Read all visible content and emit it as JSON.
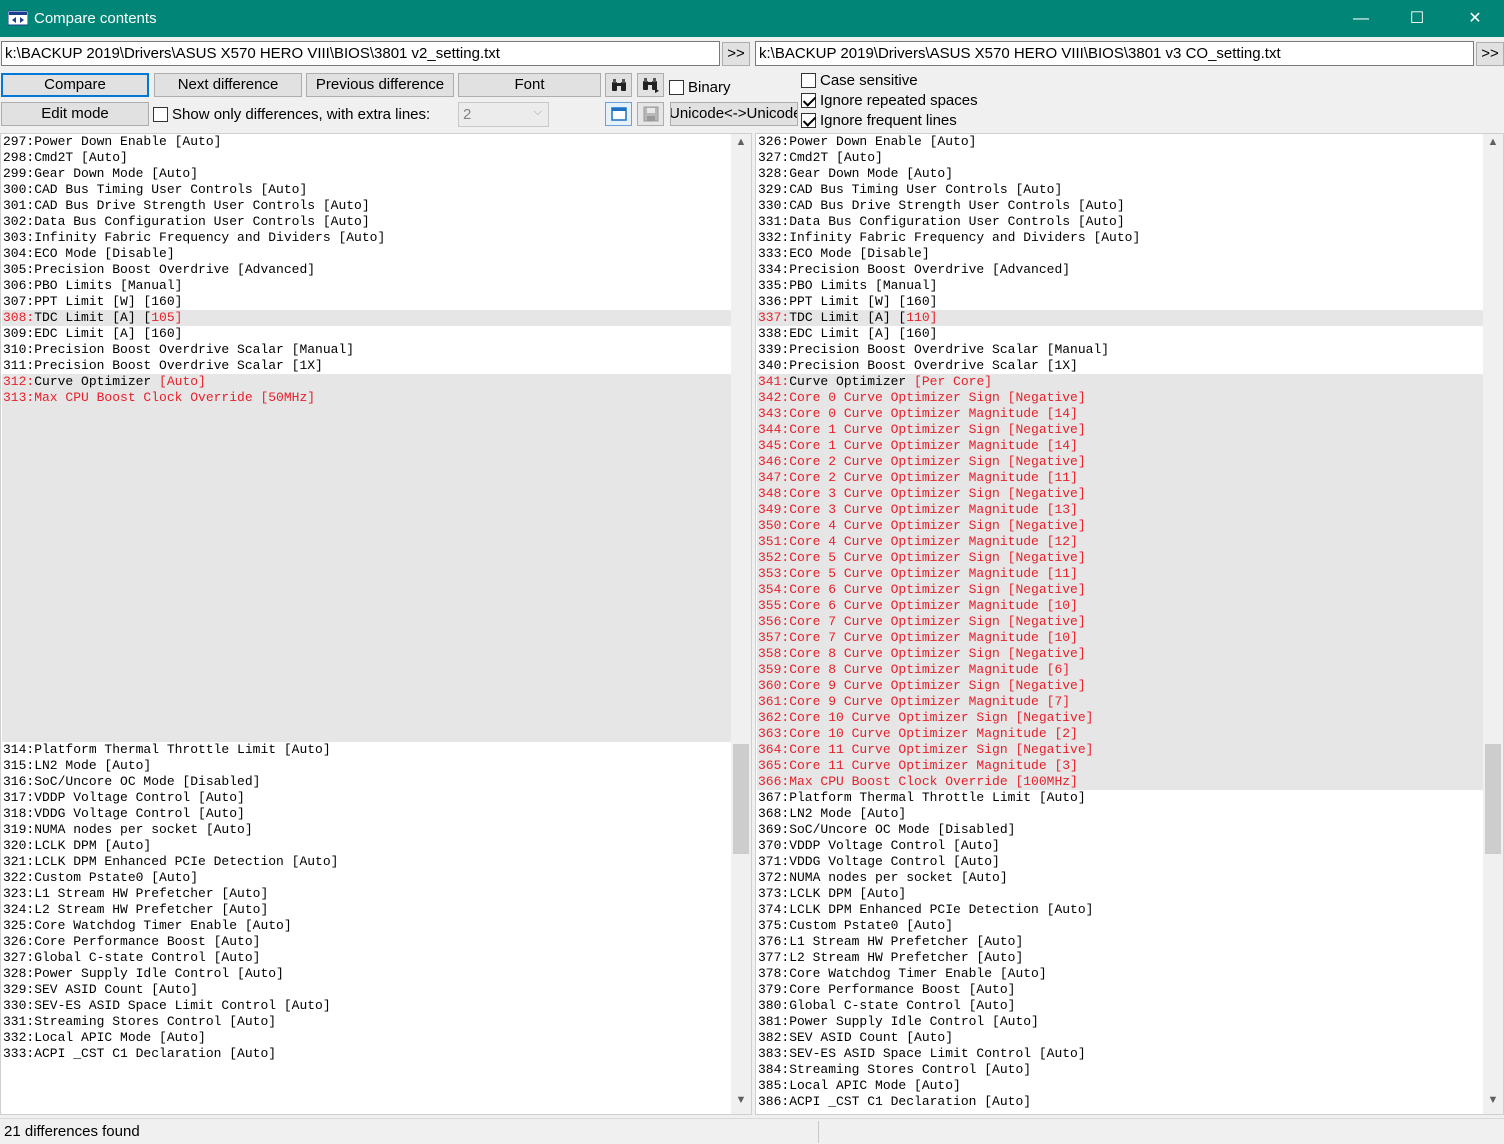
{
  "window": {
    "title": "Compare contents",
    "minimize_glyph": "—",
    "maximize_glyph": "☐",
    "close_glyph": "✕",
    "accent_color": "#008577"
  },
  "left_path": "k:\\BACKUP 2019\\Drivers\\ASUS X570 HERO VIII\\BIOS\\3801 v2_setting.txt",
  "right_path": "k:\\BACKUP 2019\\Drivers\\ASUS X570 HERO VIII\\BIOS\\3801 v3 CO_setting.txt",
  "toolbar": {
    "browse_label": ">>",
    "compare_label": "Compare",
    "next_label": "Next difference",
    "previous_label": "Previous difference",
    "font_label": "Font",
    "edit_label": "Edit mode",
    "binary_label": "Binary",
    "show_only_label": "Show only differences, with extra lines:",
    "extra_lines_value": "2",
    "unicode_label": "Unicode<->Unicode",
    "case_sensitive_label": "Case sensitive",
    "ignore_spaces_label": "Ignore repeated spaces",
    "ignore_frequent_label": "Ignore frequent lines",
    "icons": [
      "find-icon",
      "find-next-icon",
      "window-icon",
      "save-icon"
    ]
  },
  "options": {
    "binary": false,
    "show_only_differences": false,
    "case_sensitive": false,
    "ignore_repeated_spaces": true,
    "ignore_frequent_lines": true
  },
  "left_lines": [
    {
      "text": "297:Power Down Enable [Auto]"
    },
    {
      "text": "298:Cmd2T [Auto]"
    },
    {
      "text": "299:Gear Down Mode [Auto]"
    },
    {
      "text": "300:CAD Bus Timing User Controls [Auto]"
    },
    {
      "text": "301:CAD Bus Drive Strength User Controls [Auto]"
    },
    {
      "text": "302:Data Bus Configuration User Controls [Auto]"
    },
    {
      "text": "303:Infinity Fabric Frequency and Dividers [Auto]"
    },
    {
      "text": "304:ECO Mode [Disable]"
    },
    {
      "text": "305:Precision Boost Overdrive [Advanced]"
    },
    {
      "text": "306:PBO Limits [Manual]"
    },
    {
      "text": "307:PPT Limit [W] [160]"
    },
    {
      "num": "308:",
      "text": "TDC Limit [A] [",
      "diff": "105]",
      "shade": true
    },
    {
      "text": "309:EDC Limit [A] [160]"
    },
    {
      "text": "310:Precision Boost Overdrive Scalar [Manual]"
    },
    {
      "text": "311:Precision Boost Overdrive Scalar [1X]"
    },
    {
      "num": "312:",
      "text": "Curve Optimizer ",
      "diff": "[Auto]",
      "shade": true
    },
    {
      "text": "313:Max CPU Boost Clock Override [50MHz]",
      "red": true,
      "shade": true
    },
    {
      "text": "",
      "filler": true
    },
    {
      "text": "",
      "filler": true
    },
    {
      "text": "",
      "filler": true
    },
    {
      "text": "",
      "filler": true
    },
    {
      "text": "",
      "filler": true
    },
    {
      "text": "",
      "filler": true
    },
    {
      "text": "",
      "filler": true
    },
    {
      "text": "",
      "filler": true
    },
    {
      "text": "",
      "filler": true
    },
    {
      "text": "",
      "filler": true
    },
    {
      "text": "",
      "filler": true
    },
    {
      "text": "",
      "filler": true
    },
    {
      "text": "",
      "filler": true
    },
    {
      "text": "",
      "filler": true
    },
    {
      "text": "",
      "filler": true
    },
    {
      "text": "",
      "filler": true
    },
    {
      "text": "",
      "filler": true
    },
    {
      "text": "",
      "filler": true
    },
    {
      "text": "",
      "filler": true
    },
    {
      "text": "",
      "filler": true
    },
    {
      "text": "",
      "filler": true
    },
    {
      "text": "314:Platform Thermal Throttle Limit [Auto]"
    },
    {
      "text": "315:LN2 Mode [Auto]"
    },
    {
      "text": "316:SoC/Uncore OC Mode [Disabled]"
    },
    {
      "text": "317:VDDP Voltage Control [Auto]"
    },
    {
      "text": "318:VDDG Voltage Control [Auto]"
    },
    {
      "text": "319:NUMA nodes per socket [Auto]"
    },
    {
      "text": "320:LCLK DPM [Auto]"
    },
    {
      "text": "321:LCLK DPM Enhanced PCIe Detection [Auto]"
    },
    {
      "text": "322:Custom Pstate0 [Auto]"
    },
    {
      "text": "323:L1 Stream HW Prefetcher [Auto]"
    },
    {
      "text": "324:L2 Stream HW Prefetcher [Auto]"
    },
    {
      "text": "325:Core Watchdog Timer Enable [Auto]"
    },
    {
      "text": "326:Core Performance Boost [Auto]"
    },
    {
      "text": "327:Global C-state Control [Auto]"
    },
    {
      "text": "328:Power Supply Idle Control [Auto]"
    },
    {
      "text": "329:SEV ASID Count [Auto]"
    },
    {
      "text": "330:SEV-ES ASID Space Limit Control [Auto]"
    },
    {
      "text": "331:Streaming Stores Control [Auto]"
    },
    {
      "text": "332:Local APIC Mode [Auto]"
    },
    {
      "text": "333:ACPI _CST C1 Declaration [Auto]"
    }
  ],
  "right_lines": [
    {
      "text": "326:Power Down Enable [Auto]"
    },
    {
      "text": "327:Cmd2T [Auto]"
    },
    {
      "text": "328:Gear Down Mode [Auto]"
    },
    {
      "text": "329:CAD Bus Timing User Controls [Auto]"
    },
    {
      "text": "330:CAD Bus Drive Strength User Controls [Auto]"
    },
    {
      "text": "331:Data Bus Configuration User Controls [Auto]"
    },
    {
      "text": "332:Infinity Fabric Frequency and Dividers [Auto]"
    },
    {
      "text": "333:ECO Mode [Disable]"
    },
    {
      "text": "334:Precision Boost Overdrive [Advanced]"
    },
    {
      "text": "335:PBO Limits [Manual]"
    },
    {
      "text": "336:PPT Limit [W] [160]"
    },
    {
      "num": "337:",
      "text": "TDC Limit [A] [",
      "diff": "110]",
      "shade": true
    },
    {
      "text": "338:EDC Limit [A] [160]"
    },
    {
      "text": "339:Precision Boost Overdrive Scalar [Manual]"
    },
    {
      "text": "340:Precision Boost Overdrive Scalar [1X]"
    },
    {
      "num": "341:",
      "text": "Curve Optimizer ",
      "diff": "[Per Core]",
      "shade": true
    },
    {
      "text": "342:Core 0 Curve Optimizer Sign [Negative]",
      "red": true,
      "shade": true
    },
    {
      "text": "343:Core 0 Curve Optimizer Magnitude [14]",
      "red": true,
      "shade": true
    },
    {
      "text": "344:Core 1 Curve Optimizer Sign [Negative]",
      "red": true,
      "shade": true
    },
    {
      "text": "345:Core 1 Curve Optimizer Magnitude [14]",
      "red": true,
      "shade": true
    },
    {
      "text": "346:Core 2 Curve Optimizer Sign [Negative]",
      "red": true,
      "shade": true
    },
    {
      "text": "347:Core 2 Curve Optimizer Magnitude [11]",
      "red": true,
      "shade": true
    },
    {
      "text": "348:Core 3 Curve Optimizer Sign [Negative]",
      "red": true,
      "shade": true
    },
    {
      "text": "349:Core 3 Curve Optimizer Magnitude [13]",
      "red": true,
      "shade": true
    },
    {
      "text": "350:Core 4 Curve Optimizer Sign [Negative]",
      "red": true,
      "shade": true
    },
    {
      "text": "351:Core 4 Curve Optimizer Magnitude [12]",
      "red": true,
      "shade": true
    },
    {
      "text": "352:Core 5 Curve Optimizer Sign [Negative]",
      "red": true,
      "shade": true
    },
    {
      "text": "353:Core 5 Curve Optimizer Magnitude [11]",
      "red": true,
      "shade": true
    },
    {
      "text": "354:Core 6 Curve Optimizer Sign [Negative]",
      "red": true,
      "shade": true
    },
    {
      "text": "355:Core 6 Curve Optimizer Magnitude [10]",
      "red": true,
      "shade": true
    },
    {
      "text": "356:Core 7 Curve Optimizer Sign [Negative]",
      "red": true,
      "shade": true
    },
    {
      "text": "357:Core 7 Curve Optimizer Magnitude [10]",
      "red": true,
      "shade": true
    },
    {
      "text": "358:Core 8 Curve Optimizer Sign [Negative]",
      "red": true,
      "shade": true
    },
    {
      "text": "359:Core 8 Curve Optimizer Magnitude [6]",
      "red": true,
      "shade": true
    },
    {
      "text": "360:Core 9 Curve Optimizer Sign [Negative]",
      "red": true,
      "shade": true
    },
    {
      "text": "361:Core 9 Curve Optimizer Magnitude [7]",
      "red": true,
      "shade": true
    },
    {
      "text": "362:Core 10 Curve Optimizer Sign [Negative]",
      "red": true,
      "shade": true
    },
    {
      "text": "363:Core 10 Curve Optimizer Magnitude [2]",
      "red": true,
      "shade": true
    },
    {
      "text": "364:Core 11 Curve Optimizer Sign [Negative]",
      "red": true,
      "shade": true
    },
    {
      "text": "365:Core 11 Curve Optimizer Magnitude [3]",
      "red": true,
      "shade": true
    },
    {
      "text": "366:Max CPU Boost Clock Override [100MHz]",
      "red": true,
      "shade": true
    },
    {
      "text": "367:Platform Thermal Throttle Limit [Auto]"
    },
    {
      "text": "368:LN2 Mode [Auto]"
    },
    {
      "text": "369:SoC/Uncore OC Mode [Disabled]"
    },
    {
      "text": "370:VDDP Voltage Control [Auto]"
    },
    {
      "text": "371:VDDG Voltage Control [Auto]"
    },
    {
      "text": "372:NUMA nodes per socket [Auto]"
    },
    {
      "text": "373:LCLK DPM [Auto]"
    },
    {
      "text": "374:LCLK DPM Enhanced PCIe Detection [Auto]"
    },
    {
      "text": "375:Custom Pstate0 [Auto]"
    },
    {
      "text": "376:L1 Stream HW Prefetcher [Auto]"
    },
    {
      "text": "377:L2 Stream HW Prefetcher [Auto]"
    },
    {
      "text": "378:Core Watchdog Timer Enable [Auto]"
    },
    {
      "text": "379:Core Performance Boost [Auto]"
    },
    {
      "text": "380:Global C-state Control [Auto]"
    },
    {
      "text": "381:Power Supply Idle Control [Auto]"
    },
    {
      "text": "382:SEV ASID Count [Auto]"
    },
    {
      "text": "383:SEV-ES ASID Space Limit Control [Auto]"
    },
    {
      "text": "384:Streaming Stores Control [Auto]"
    },
    {
      "text": "385:Local APIC Mode [Auto]"
    },
    {
      "text": "386:ACPI _CST C1 Declaration [Auto]"
    }
  ],
  "status": {
    "text": "21 differences found"
  },
  "colors": {
    "diff_text": "#e8202a",
    "diff_background": "#e6e6e6",
    "focus_border": "#0078d7"
  }
}
